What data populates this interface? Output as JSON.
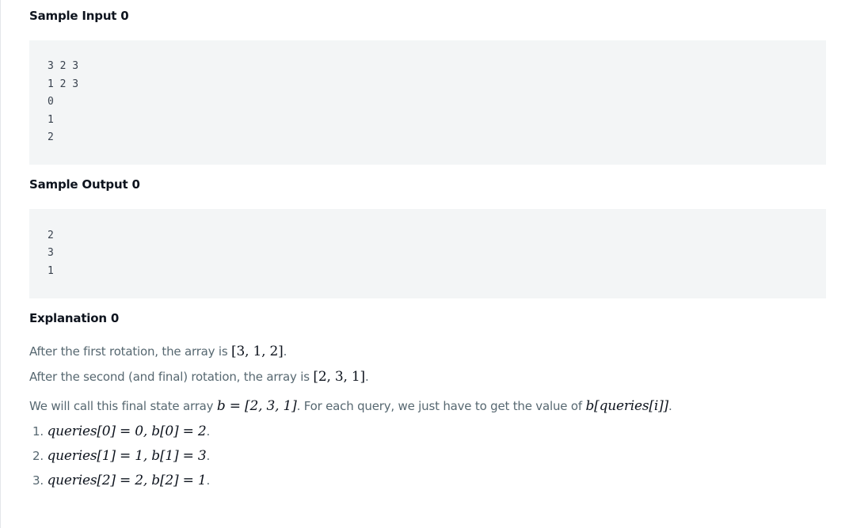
{
  "sample_input": {
    "heading": "Sample Input 0",
    "lines": [
      "3 2 3",
      "1 2 3",
      "0",
      "1",
      "2"
    ]
  },
  "sample_output": {
    "heading": "Sample Output 0",
    "lines": [
      "2",
      "3",
      "1"
    ]
  },
  "explanation": {
    "heading": "Explanation 0",
    "rotation1_text": "After the first rotation, the array is ",
    "rotation1_math": "[3, 1, 2]",
    "rotation2_text": "After the second (and final) rotation, the array is ",
    "rotation2_math": "[2, 3, 1]",
    "final_text_a": "We will call this final state array ",
    "final_math_b": "b = [2, 3, 1]",
    "final_text_b": ". For each query, we just have to get the value of ",
    "final_math_q": "b[queries[i]]",
    "items": [
      {
        "num": "1.",
        "math": "queries[0] = 0, b[0] = 2"
      },
      {
        "num": "2.",
        "math": "queries[1] = 1, b[1] = 3"
      },
      {
        "num": "3.",
        "math": "queries[2] = 2, b[2] = 1"
      }
    ]
  }
}
